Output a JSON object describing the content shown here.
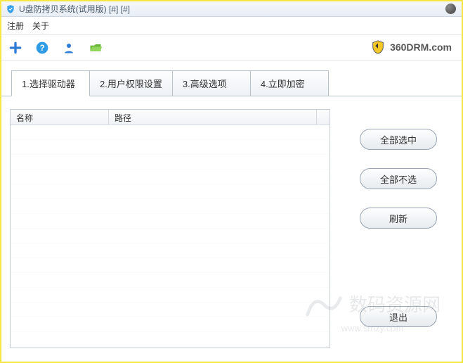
{
  "titlebar": {
    "title": "U盘防拷贝系统(试用版)  [#]  [#]"
  },
  "menubar": {
    "register": "注册",
    "about": "关于"
  },
  "brand": {
    "text": "360DRM.com"
  },
  "tabs": [
    {
      "label": "1.选择驱动器",
      "active": true
    },
    {
      "label": "2.用户权限设置",
      "active": false
    },
    {
      "label": "3.高级选项",
      "active": false
    },
    {
      "label": "4.立即加密",
      "active": false
    }
  ],
  "table": {
    "columns": {
      "name": "名称",
      "path": "路径"
    },
    "rows": []
  },
  "buttons": {
    "select_all": "全部选中",
    "select_none": "全部不选",
    "refresh": "刷新",
    "exit": "退出"
  },
  "watermark": {
    "title": "数码资源网",
    "url": "www.smzy.com"
  }
}
